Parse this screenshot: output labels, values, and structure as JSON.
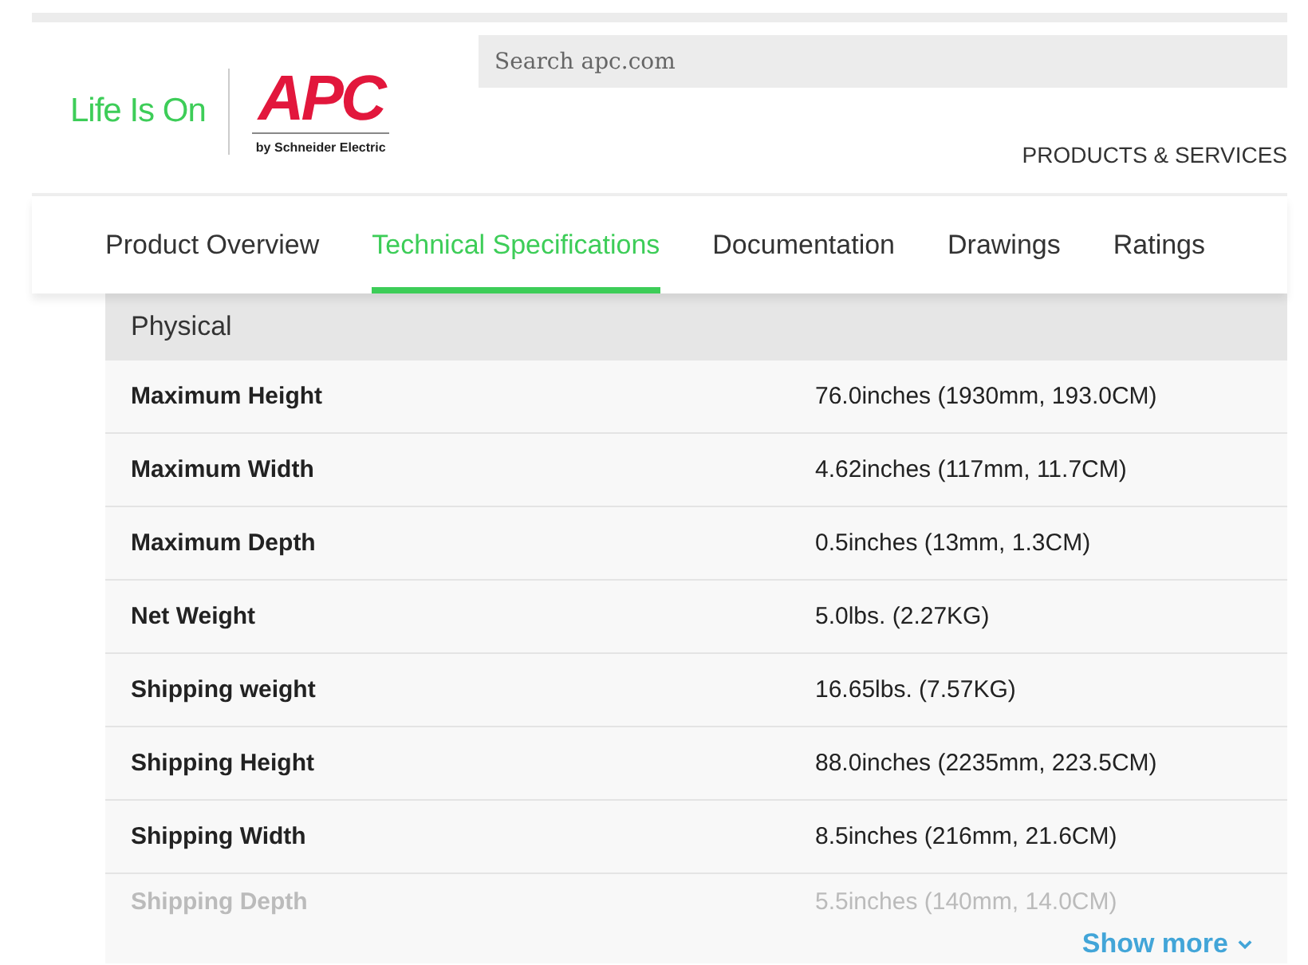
{
  "header": {
    "tagline": "Life Is On",
    "logo": "APC",
    "logo_sub": "by Schneider Electric",
    "search": {
      "placeholder": "Search apc.com"
    },
    "nav": "PRODUCTS & SERVICES"
  },
  "tabs": [
    {
      "label": "Product Overview",
      "selected": false
    },
    {
      "label": "Technical Specifications",
      "selected": true
    },
    {
      "label": "Documentation",
      "selected": false
    },
    {
      "label": "Drawings",
      "selected": false
    },
    {
      "label": "Ratings",
      "selected": false
    }
  ],
  "section": {
    "title": "Physical",
    "rows": [
      {
        "name": "Maximum Height",
        "value": "76.0inches (1930mm, 193.0CM)",
        "faded": false
      },
      {
        "name": "Maximum Width",
        "value": "4.62inches (117mm, 11.7CM)",
        "faded": false
      },
      {
        "name": "Maximum Depth",
        "value": "0.5inches (13mm, 1.3CM)",
        "faded": false
      },
      {
        "name": "Net Weight",
        "value": "5.0lbs. (2.27KG)",
        "faded": false
      },
      {
        "name": "Shipping weight",
        "value": "16.65lbs. (7.57KG)",
        "faded": false
      },
      {
        "name": "Shipping Height",
        "value": "88.0inches (2235mm, 223.5CM)",
        "faded": false
      },
      {
        "name": "Shipping Width",
        "value": "8.5inches (216mm, 21.6CM)",
        "faded": false
      },
      {
        "name": "Shipping Depth",
        "value": "5.5inches (140mm, 14.0CM)",
        "faded": true
      }
    ],
    "more": "Show more"
  }
}
